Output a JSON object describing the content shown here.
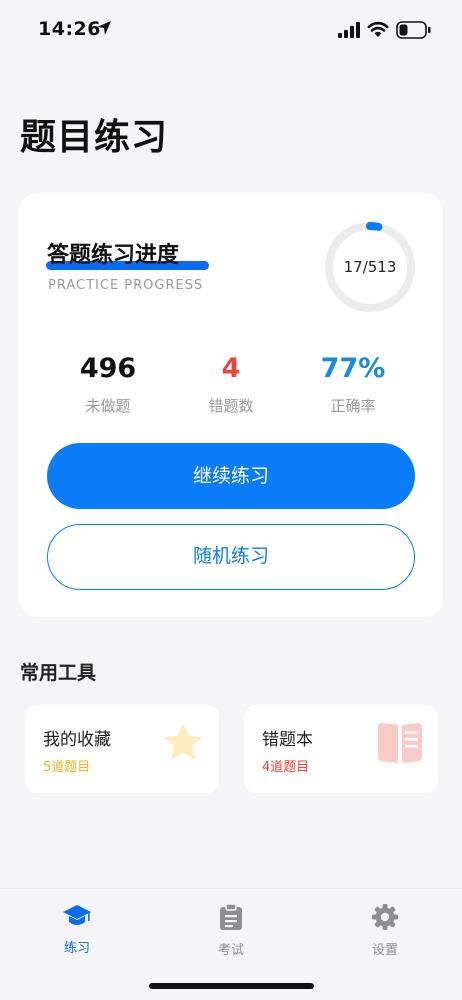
{
  "status_bar": {
    "time": "14:26"
  },
  "page": {
    "title": "题目练习"
  },
  "progress_card": {
    "title": "答题练习进度",
    "subtitle": "PRACTICE PROGRESS",
    "progress_text": "17/513",
    "progress_fraction": 0.033,
    "stats": [
      {
        "value": "496",
        "label": "未做题",
        "color": "#111111"
      },
      {
        "value": "4",
        "label": "错题数",
        "color": "#e8453c"
      },
      {
        "value": "77%",
        "label": "正确率",
        "color": "#1a8be0"
      }
    ],
    "continue_label": "继续练习",
    "random_label": "随机练习"
  },
  "tools": {
    "section_title": "常用工具",
    "favorites": {
      "title": "我的收藏",
      "count": "5道题目",
      "color": "#f5b324"
    },
    "mistakes": {
      "title": "错题本",
      "count": "4道题目",
      "color": "#e8453c"
    }
  },
  "tab_bar": {
    "items": [
      {
        "label": "练习",
        "icon": "graduation-cap-icon",
        "active": true
      },
      {
        "label": "考试",
        "icon": "clipboard-icon",
        "active": false
      },
      {
        "label": "设置",
        "icon": "gear-icon",
        "active": false
      }
    ],
    "active_color": "#0a6cf5",
    "inactive_color": "#8e8e93"
  }
}
